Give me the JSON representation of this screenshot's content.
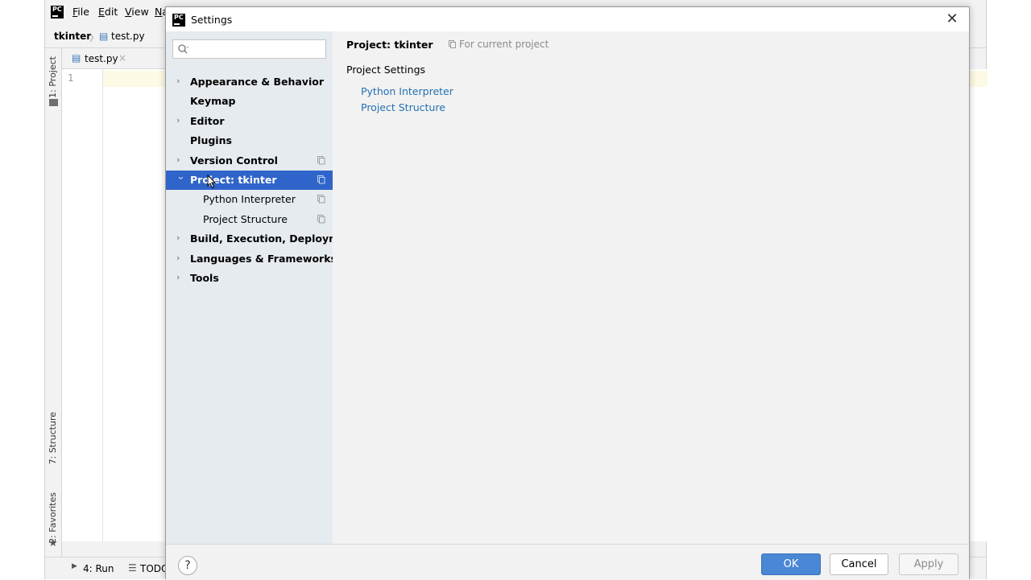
{
  "ide": {
    "menu": [
      "File",
      "Edit",
      "View",
      "Na"
    ],
    "menu_mnemonics": [
      "F",
      "E",
      "V",
      "N"
    ],
    "breadcrumb": {
      "project": "tkinter",
      "file": "test.py"
    },
    "editor_tab": "test.py",
    "line_number": "1",
    "left_tabs": {
      "project": "1: Project",
      "structure": "7: Structure",
      "favorites": "2: Favorites"
    },
    "status_tabs": {
      "run": "4: Run",
      "todo": "TODO"
    }
  },
  "dialog": {
    "title": "Settings",
    "search": {
      "placeholder": "",
      "value": ""
    },
    "tree": [
      {
        "label": "Appearance & Behavior",
        "bold": true,
        "expandable": true,
        "level": 0,
        "project_icon": false,
        "selected": false
      },
      {
        "label": "Keymap",
        "bold": true,
        "expandable": false,
        "level": 0,
        "project_icon": false,
        "selected": false
      },
      {
        "label": "Editor",
        "bold": true,
        "expandable": true,
        "level": 0,
        "project_icon": false,
        "selected": false
      },
      {
        "label": "Plugins",
        "bold": true,
        "expandable": false,
        "level": 0,
        "project_icon": false,
        "selected": false
      },
      {
        "label": "Version Control",
        "bold": true,
        "expandable": true,
        "level": 0,
        "project_icon": true,
        "selected": false
      },
      {
        "label": "Project: tkinter",
        "bold": true,
        "expandable": true,
        "expanded": true,
        "level": 0,
        "project_icon": true,
        "selected": true
      },
      {
        "label": "Python Interpreter",
        "bold": false,
        "expandable": false,
        "level": 1,
        "project_icon": true,
        "selected": false
      },
      {
        "label": "Project Structure",
        "bold": false,
        "expandable": false,
        "level": 1,
        "project_icon": true,
        "selected": false
      },
      {
        "label": "Build, Execution, Deployment",
        "bold": true,
        "expandable": true,
        "level": 0,
        "project_icon": false,
        "selected": false
      },
      {
        "label": "Languages & Frameworks",
        "bold": true,
        "expandable": true,
        "level": 0,
        "project_icon": false,
        "selected": false
      },
      {
        "label": "Tools",
        "bold": true,
        "expandable": true,
        "level": 0,
        "project_icon": false,
        "selected": false
      }
    ],
    "content": {
      "title": "Project: tkinter",
      "scope_note": "For current project",
      "section": "Project Settings",
      "links": [
        "Python Interpreter",
        "Project Structure"
      ]
    },
    "buttons": {
      "help": "?",
      "ok": "OK",
      "cancel": "Cancel",
      "apply": "Apply"
    }
  },
  "colors": {
    "selection": "#2f65ca",
    "link": "#2470b3",
    "ok_button": "#4a87d4",
    "sidebar_bg": "#e6ebf0"
  },
  "icons": {
    "close": "close-icon",
    "search": "search-icon",
    "chevron": "chevron-right-icon",
    "project_scope": "project-scope-icon",
    "help": "help-icon"
  }
}
